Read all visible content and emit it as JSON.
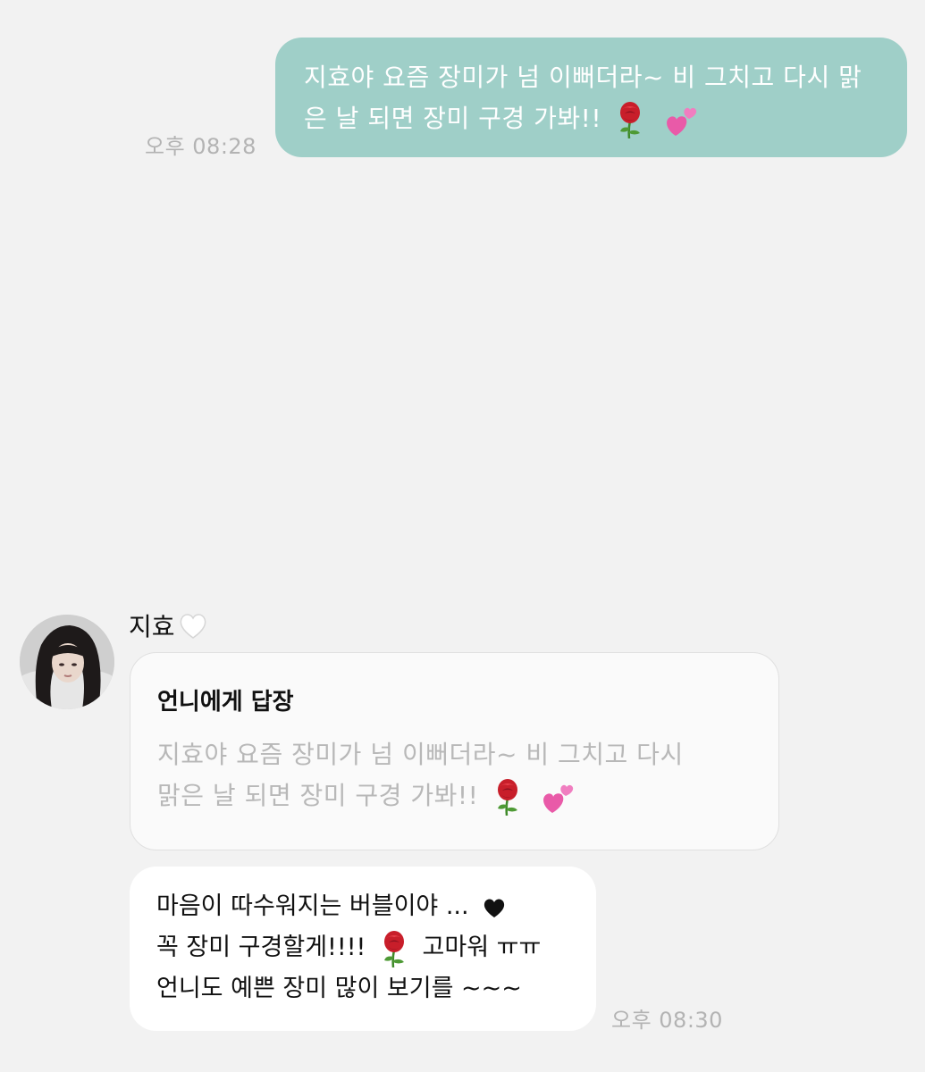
{
  "outgoing": {
    "line1": "지효야 요즘 장미가 넘 이뻐더라~ 비 그치고 다시 맑",
    "line2": "은 날 되면 장미 구경 가봐!!",
    "time": "오후 08:28"
  },
  "incoming": {
    "sender": "지효",
    "reply_header": "언니에게 답장",
    "quote_line1": "지효야 요즘 장미가 넘 이뻐더라~ 비 그치고 다시",
    "quote_line2": "맑은 날 되면 장미 구경 가봐!!",
    "line1": "마음이 따수워지는 버블이야 ...",
    "line2a": "꼭 장미 구경할게!!!!",
    "line2b": "고마워 ㅠㅠ",
    "line3": "언니도 예쁜 장미 많이 보기를 ~~~",
    "time": "오후 08:30"
  },
  "colors": {
    "background": "#f2f2f2",
    "outgoing_bubble": "#9fcfc8",
    "incoming_bubble": "#ffffff",
    "timestamp": "#b3b3b3"
  },
  "icons": [
    "rose-emoji-icon",
    "two-hearts-emoji-icon",
    "white-heart-icon",
    "black-heart-icon"
  ]
}
